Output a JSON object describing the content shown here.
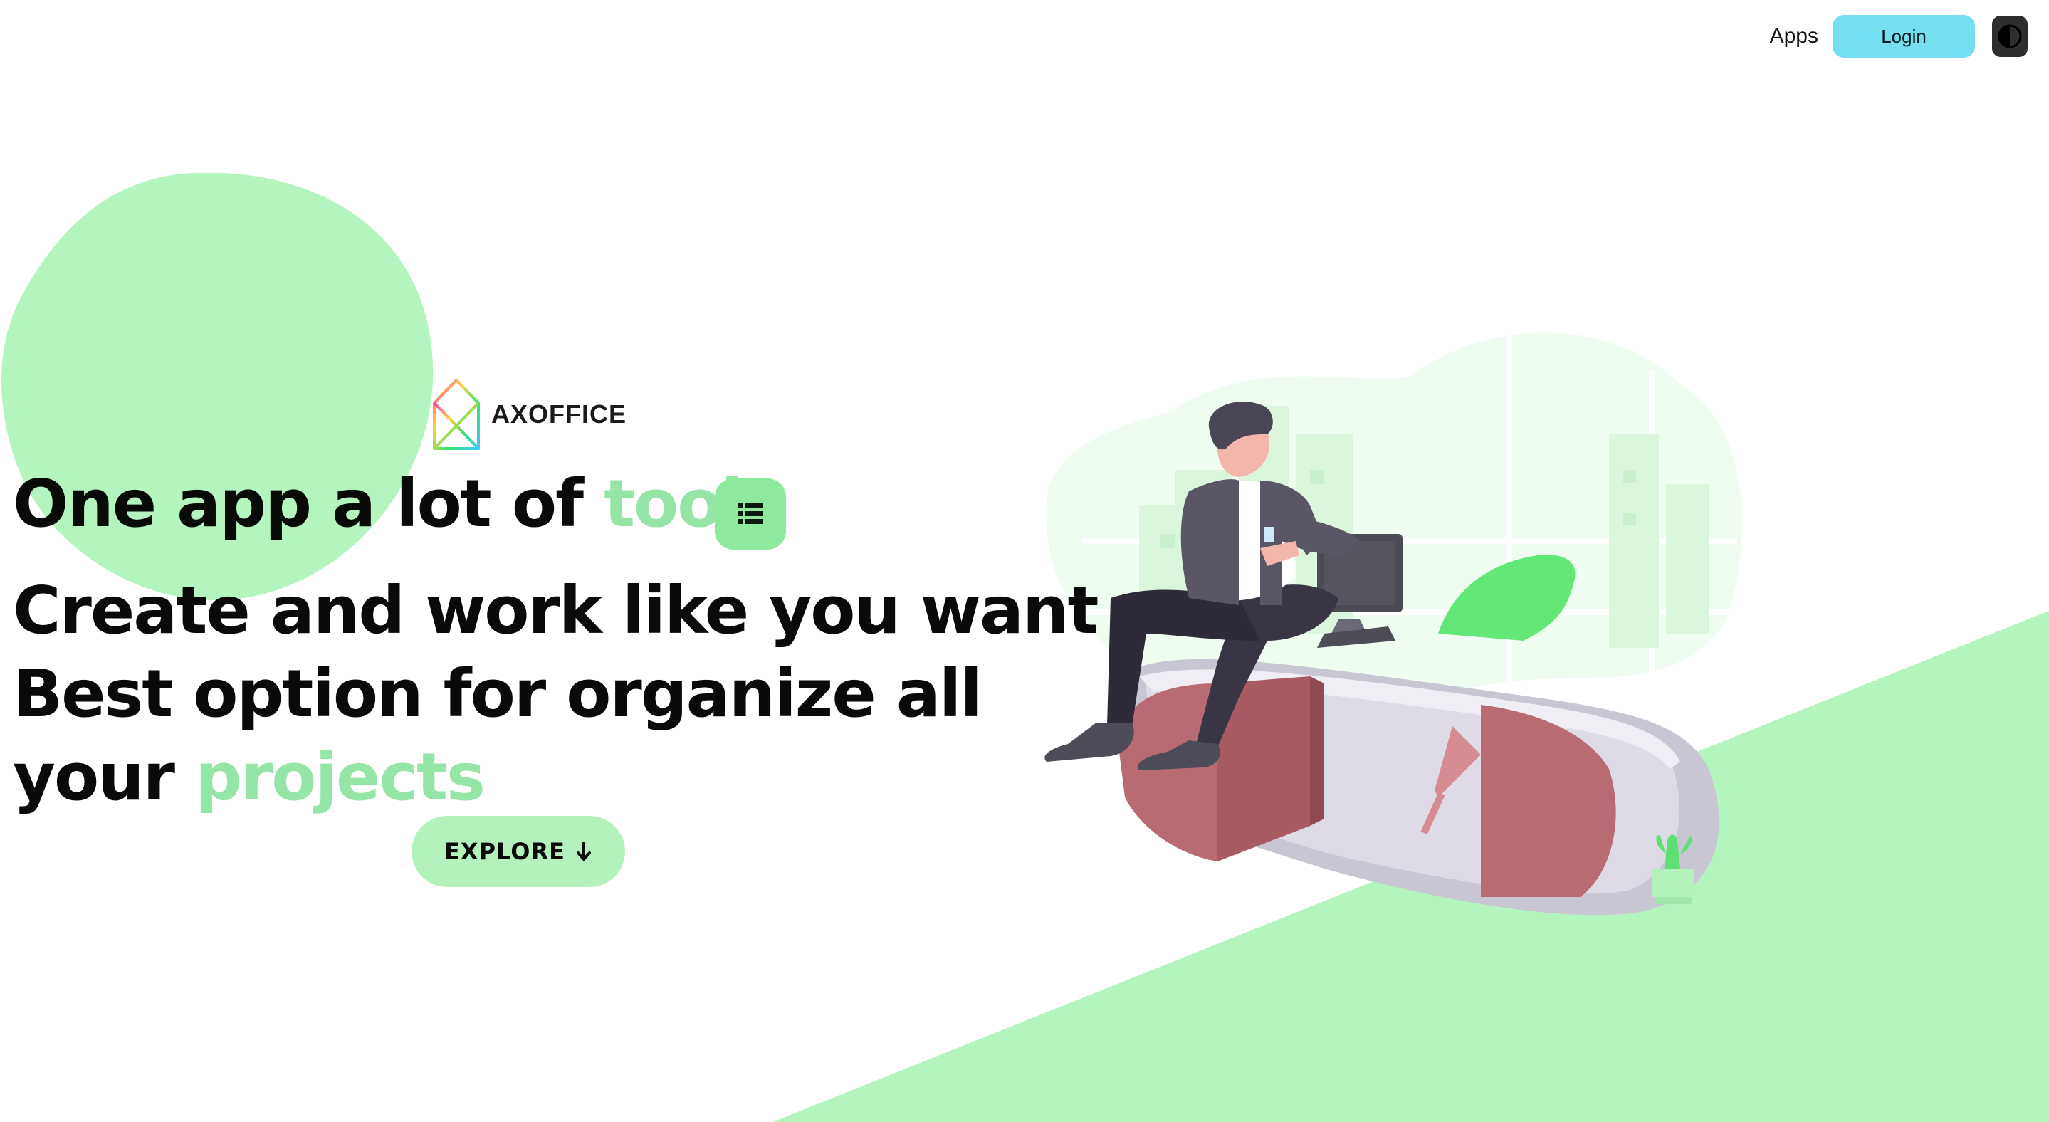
{
  "nav": {
    "apps_label": "Apps",
    "login_label": "Login",
    "theme_toggle_icon": "contrast-icon"
  },
  "brand": {
    "name": "AXOFFICE",
    "logo_icon": "house-logo-icon"
  },
  "hero": {
    "title_part1": "One app a lot of ",
    "title_highlight": "tools",
    "title_badge_icon": "list-icon",
    "line2": "Create and work like you want",
    "line3": "Best option for organize all",
    "line4_part1": "your ",
    "line4_highlight": "projects"
  },
  "cta": {
    "explore_label": "EXPLORE",
    "explore_icon": "arrow-down-icon"
  },
  "illustration": {
    "icon": "person-at-desk-illustration"
  },
  "colors": {
    "accent_green": "#95e6a6",
    "shape_green": "#b4f4bf",
    "login_blue": "#73dff1",
    "text": "#0a0a0a"
  }
}
